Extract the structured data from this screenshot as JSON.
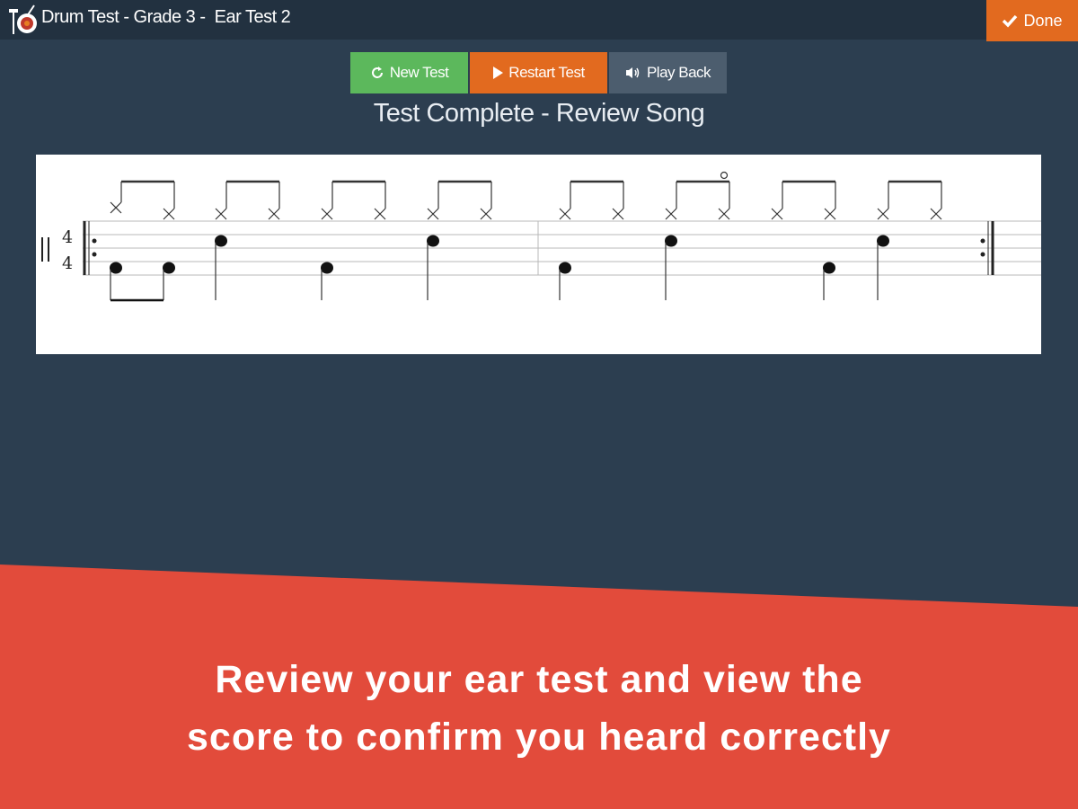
{
  "header": {
    "title": "Drum Test - Grade 3 -  Ear Test 2",
    "app_icon": "drum-icon",
    "done_label": "Done",
    "done_icon": "check-icon"
  },
  "toolbar": {
    "new_test_label": "New Test",
    "new_test_icon": "refresh-icon",
    "restart_label": "Restart Test",
    "restart_icon": "play-icon",
    "playback_label": "Play Back",
    "playback_icon": "speaker-icon"
  },
  "status_text": "Test Complete - Review Song",
  "score": {
    "time_signature_top": "4",
    "time_signature_bottom": "4",
    "measures": 2,
    "repeat": true,
    "hihat_notes_per_measure": 8,
    "open_hihat_position": "measure 2, beat 3, eighth 2"
  },
  "caption": {
    "line1": "Review your ear test and view the",
    "line2": "score to confirm you heard correctly"
  },
  "colors": {
    "background": "#2c3e50",
    "topbar": "#223140",
    "orange": "#e26a1f",
    "green": "#5cb85c",
    "grey_button": "#4c5d6e",
    "banner_red": "#e24b3b"
  }
}
